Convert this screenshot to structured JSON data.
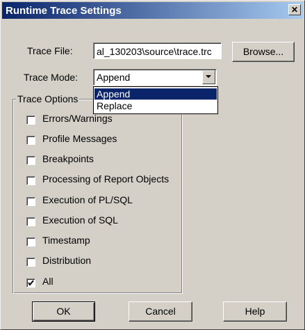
{
  "window": {
    "title": "Runtime Trace Settings",
    "close_glyph": "✕"
  },
  "trace_file": {
    "label": "Trace File:",
    "value": "al_130203\\source\\trace.trc",
    "browse_label": "Browse..."
  },
  "trace_mode": {
    "label": "Trace Mode:",
    "selected": "Append",
    "options": [
      "Append",
      "Replace"
    ]
  },
  "trace_options": {
    "legend": "Trace Options",
    "items": [
      {
        "label": "Errors/Warnings",
        "checked": false
      },
      {
        "label": "Profile Messages",
        "checked": false
      },
      {
        "label": "Breakpoints",
        "checked": false
      },
      {
        "label": "Processing of Report Objects",
        "checked": false
      },
      {
        "label": "Execution of PL/SQL",
        "checked": false
      },
      {
        "label": "Execution of SQL",
        "checked": false
      },
      {
        "label": "Timestamp",
        "checked": false
      },
      {
        "label": "Distribution",
        "checked": false
      },
      {
        "label": "All",
        "checked": true
      }
    ]
  },
  "buttons": {
    "ok": "OK",
    "cancel": "Cancel",
    "help": "Help"
  },
  "colors": {
    "face": "#d4d0c8",
    "title_start": "#0a246a",
    "title_end": "#a6caf0",
    "highlight": "#0a246a"
  }
}
